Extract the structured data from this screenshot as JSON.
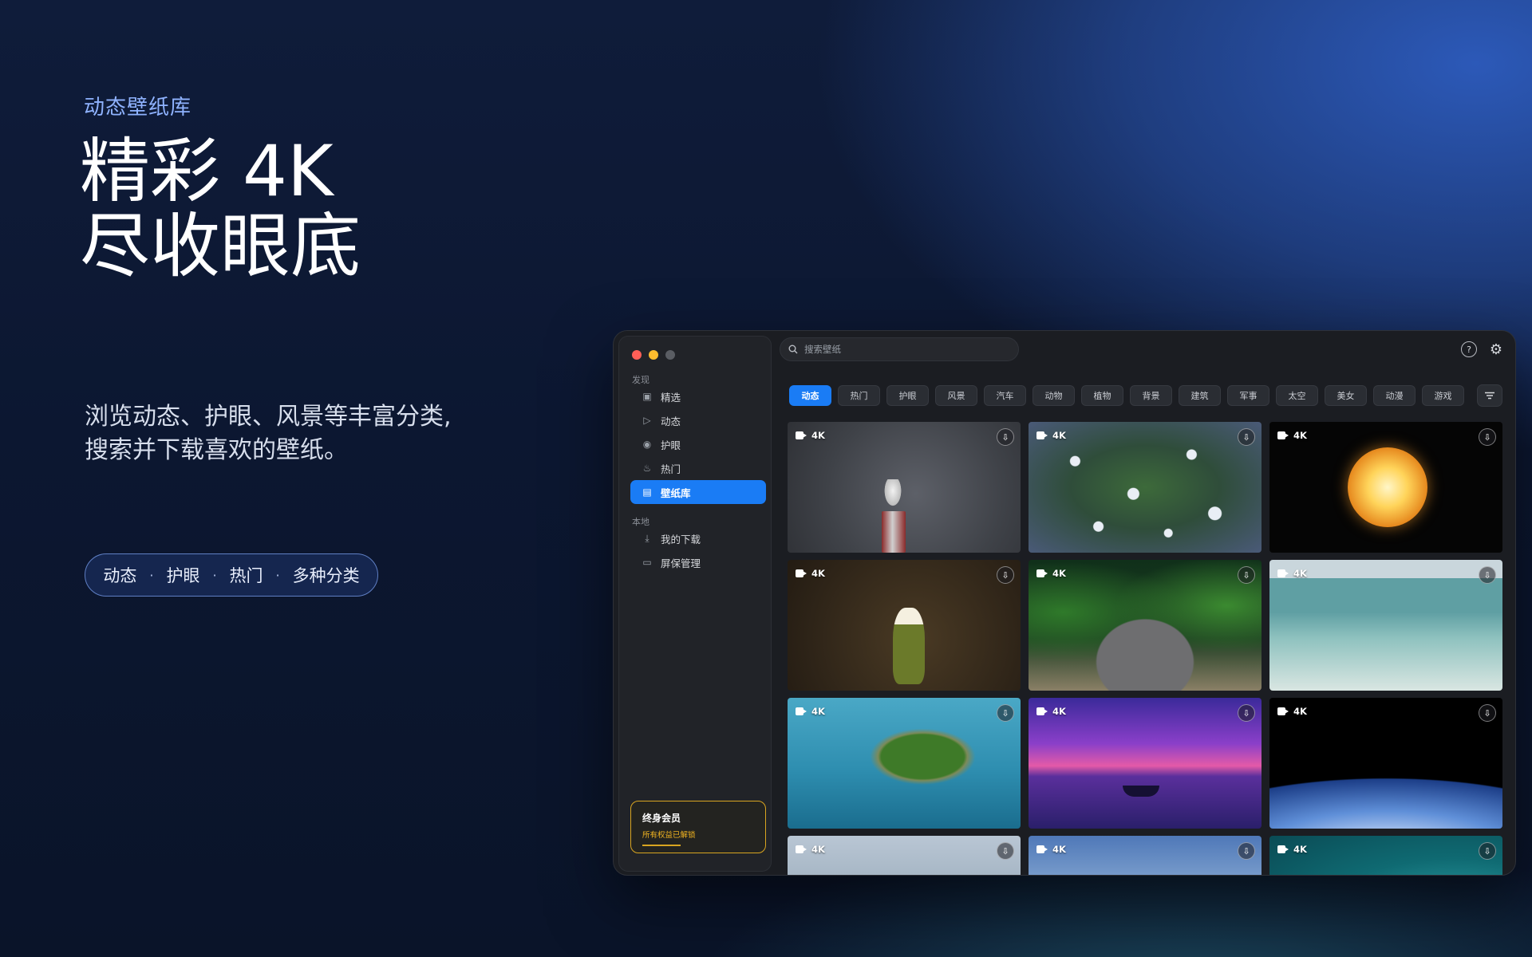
{
  "hero": {
    "eyebrow": "动态壁纸库",
    "headline_line1": "精彩 4K",
    "headline_line2": "尽收眼底",
    "desc_line1": "浏览动态、护眼、风景等丰富分类,",
    "desc_line2": "搜索并下载喜欢的壁纸。",
    "pill_items": [
      "动态",
      "护眼",
      "热门",
      "多种分类"
    ],
    "pill_sep": "·"
  },
  "app": {
    "colors": {
      "accent": "#1a7cf5",
      "gold": "#d9a520",
      "close": "#ff5f57",
      "minimize": "#febc2e",
      "zoom": "#5a5d63"
    },
    "sidebar": {
      "discover_label": "发现",
      "local_label": "本地",
      "discover_items": [
        {
          "label": "精选",
          "icon": "featured-icon"
        },
        {
          "label": "动态",
          "icon": "play-icon"
        },
        {
          "label": "护眼",
          "icon": "eye-icon"
        },
        {
          "label": "热门",
          "icon": "flame-icon"
        },
        {
          "label": "壁纸库",
          "icon": "gallery-icon",
          "active": true
        }
      ],
      "local_items": [
        {
          "label": "我的下载",
          "icon": "download-icon"
        },
        {
          "label": "屏保管理",
          "icon": "monitor-icon"
        }
      ],
      "member": {
        "title": "终身会员",
        "subtitle": "所有权益已解锁"
      }
    },
    "search": {
      "placeholder": "搜索壁纸"
    },
    "categories": [
      "动态",
      "热门",
      "护眼",
      "风景",
      "汽车",
      "动物",
      "植物",
      "背景",
      "建筑",
      "军事",
      "太空",
      "美女",
      "动漫",
      "游戏"
    ],
    "active_category": "动态",
    "badge_label": "4K",
    "wallpapers": [
      {
        "theme": "gull"
      },
      {
        "theme": "flowers"
      },
      {
        "theme": "sun"
      },
      {
        "theme": "dande"
      },
      {
        "theme": "aqua"
      },
      {
        "theme": "sea"
      },
      {
        "theme": "island"
      },
      {
        "theme": "boat"
      },
      {
        "theme": "earth"
      },
      {
        "theme": "hills"
      },
      {
        "theme": "sky"
      },
      {
        "theme": "coast"
      }
    ]
  }
}
